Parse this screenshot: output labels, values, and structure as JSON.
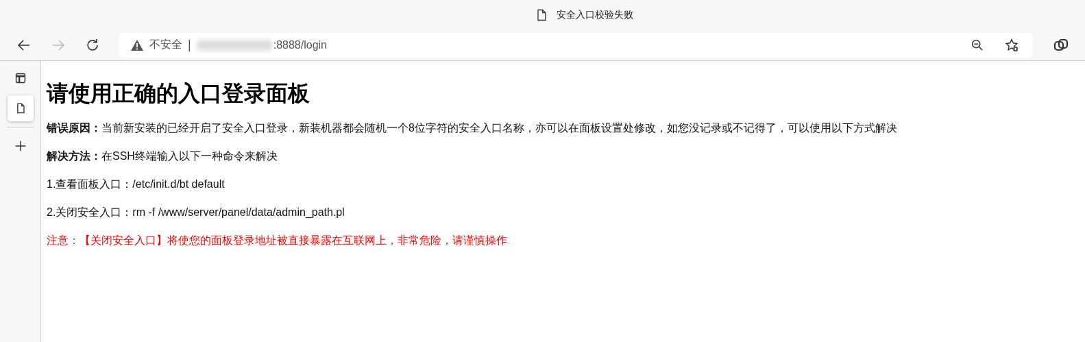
{
  "window": {
    "title": "安全入口校验失败"
  },
  "toolbar": {
    "forward_disabled": true,
    "security_label": "不安全",
    "separator": "|",
    "url": ":8888/login"
  },
  "sidebar_tabs": [
    {
      "selected": true
    }
  ],
  "page": {
    "heading": "请使用正确的入口登录面板",
    "paragraphs": [
      {
        "kind": "normal",
        "text": "**错误原因：**当前新安装的已经开启了安全入口登录，新装机器都会随机一个8位字符的安全入口名称，亦可以在面板设置处修改，如您没记录或不记得了，可以使用以下方式解决"
      },
      {
        "kind": "normal",
        "text": "**解决方法：**在SSH终端输入以下一种命令来解决"
      },
      {
        "kind": "normal",
        "text": "1.查看面板入口：/etc/init.d/bt default"
      },
      {
        "kind": "normal",
        "text": "2.关闭安全入口：rm -f /www/server/panel/data/admin_path.pl"
      },
      {
        "kind": "warning",
        "text": "注意：【关闭安全入口】将使您的面板登录地址被直接暴露在互联网上，非常危险，请谨慎操作"
      }
    ]
  }
}
